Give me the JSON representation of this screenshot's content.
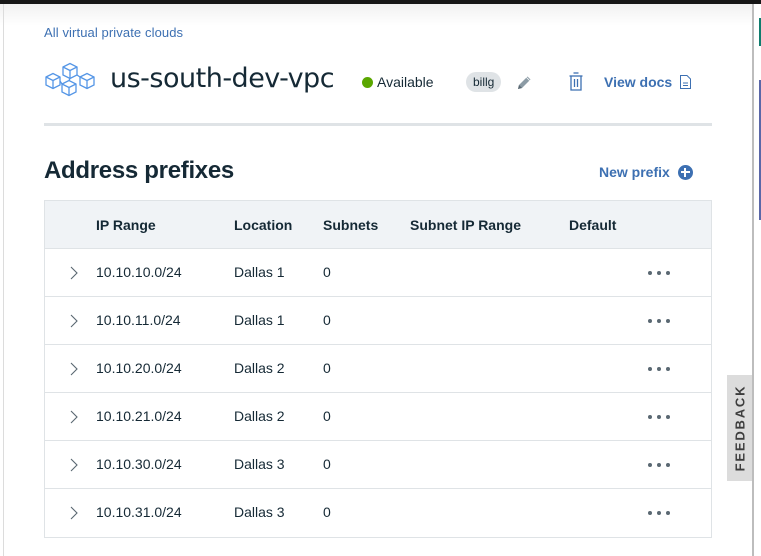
{
  "breadcrumb": {
    "back_link": "All virtual private clouds"
  },
  "header": {
    "title": "us-south-dev-vpc",
    "status": {
      "label": "Available",
      "color": "#5aa700"
    },
    "tag": "billg",
    "view_docs": "View docs",
    "icons": {
      "resource": "vpc-cubes-icon",
      "edit": "pencil-icon",
      "delete": "trash-icon",
      "docs": "document-icon"
    }
  },
  "section": {
    "title": "Address prefixes",
    "new_prefix_label": "New prefix"
  },
  "table": {
    "columns": [
      "IP Range",
      "Location",
      "Subnets",
      "Subnet IP Range",
      "Default"
    ],
    "rows": [
      {
        "ip_range": "10.10.10.0/24",
        "location": "Dallas 1",
        "subnets": "0",
        "subnet_ip_range": "",
        "default": ""
      },
      {
        "ip_range": "10.10.11.0/24",
        "location": "Dallas 1",
        "subnets": "0",
        "subnet_ip_range": "",
        "default": ""
      },
      {
        "ip_range": "10.10.20.0/24",
        "location": "Dallas 2",
        "subnets": "0",
        "subnet_ip_range": "",
        "default": ""
      },
      {
        "ip_range": "10.10.21.0/24",
        "location": "Dallas 2",
        "subnets": "0",
        "subnet_ip_range": "",
        "default": ""
      },
      {
        "ip_range": "10.10.30.0/24",
        "location": "Dallas 3",
        "subnets": "0",
        "subnet_ip_range": "",
        "default": ""
      },
      {
        "ip_range": "10.10.31.0/24",
        "location": "Dallas 3",
        "subnets": "0",
        "subnet_ip_range": "",
        "default": ""
      }
    ]
  },
  "feedback": {
    "label": "FEEDBACK"
  },
  "colors": {
    "link": "#3d70b2",
    "text": "#152935",
    "header_bg": "#f0f3f6",
    "border": "#dfe3e6"
  }
}
